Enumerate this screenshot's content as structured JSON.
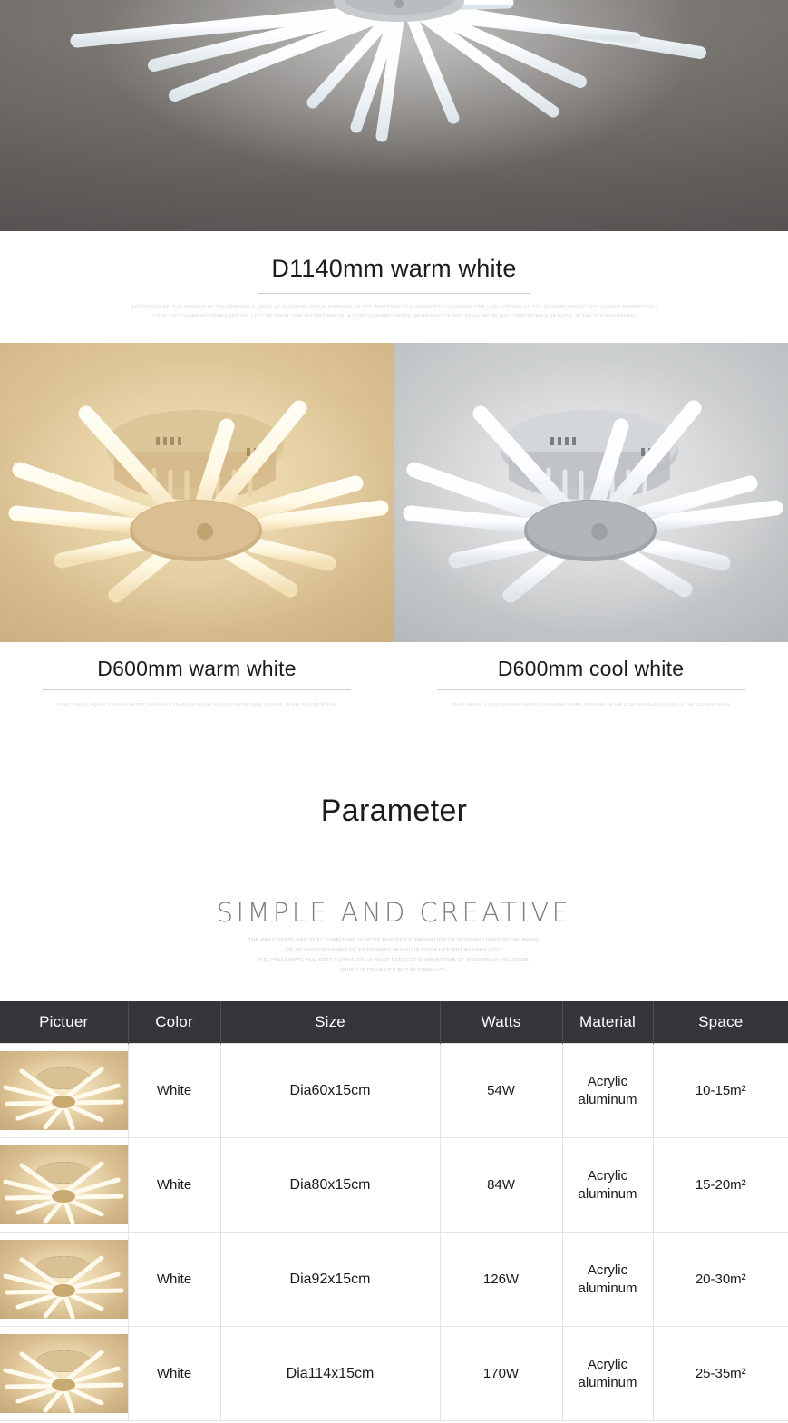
{
  "hero": {
    "alt_name": "led-ceiling-lamp-cool-white-hero"
  },
  "sections": [
    {
      "title": "D1140mm warm white",
      "sub_lines": [
        "SCATTERED ON THE WINDOW OF THE UMBRELLA, WAKE UP SLEEPING IN THE MORNING, IN THE WINTER OF THE DESOLATE, FLAWLESS PINK LACE, PICKED UP THE AUTUMN SUNSET OFF LUXURY PHNOM PENH",
        "LOVE THIS CHARMING TEMPERATURE, LEFT TO THEIR OWN INSTANT FRESH, A QUIET EVENING WATER, REMAINING YEARS, REVELING IN THE COMFORTABLE FASHION, IN THE GOLDEN DREAM"
      ]
    }
  ],
  "duo": {
    "left": {
      "title": "D600mm warm white",
      "sub": "START FRESH, A QUIET EVENING WATER, REMAINING YEARS, REVELING IN THE COMFORTABLE FASHION, IN THE GOLDEN DREAM",
      "image_name": "led-ceiling-lamp-warm-white"
    },
    "right": {
      "title": "D600mm cool white",
      "sub": "START FRESH, A QUIET EVENING WATER, REMAINING YEARS, REVELING IN THE COMFORTABLE FASHION, IN THE GOLDEN DREAM",
      "image_name": "led-ceiling-lamp-cool-white"
    }
  },
  "parameter": {
    "heading": "Parameter",
    "subheading": "SIMPLE AND CREATIVE",
    "sub_lines": [
      "THE PASSIONATE AND SOFT FURNITURE IS MOST PERFECT COMBINATION OF MODERN LIVING ROOM, BRING",
      "US TO ANOTHER AMBIT OF ENJOYMENT, WHICH IS FROM LIFE BUT BEYOND LIFE.",
      "THE PASSIONATE AND SOFT FURNITURE IS MOST PERFECT COMBINATION OF MODERN LIVING ROOM,",
      "WHICH IS FROM LIFE BUT BEYOND LIFE."
    ]
  },
  "spec_table": {
    "headers": [
      "Pictuer",
      "Color",
      "Size",
      "Watts",
      "Material",
      "Space"
    ],
    "rows": [
      {
        "color": "White",
        "size": "Dia60x15cm",
        "watts": "54W",
        "material": "Acrylic aluminum",
        "space": "10-15m²"
      },
      {
        "color": "White",
        "size": "Dia80x15cm",
        "watts": "84W",
        "material": "Acrylic aluminum",
        "space": "15-20m²"
      },
      {
        "color": "White",
        "size": "Dia92x15cm",
        "watts": "126W",
        "material": "Acrylic aluminum",
        "space": "20-30m²"
      },
      {
        "color": "White",
        "size": "Dia114x15cm",
        "watts": "170W",
        "material": "Acrylic aluminum",
        "space": "25-35m²"
      }
    ]
  },
  "colors": {
    "table_header_bg": "#343639",
    "table_border": "#e3e3e3",
    "heading_text": "#1c1c1c",
    "faint_text": "#cbccd1"
  }
}
